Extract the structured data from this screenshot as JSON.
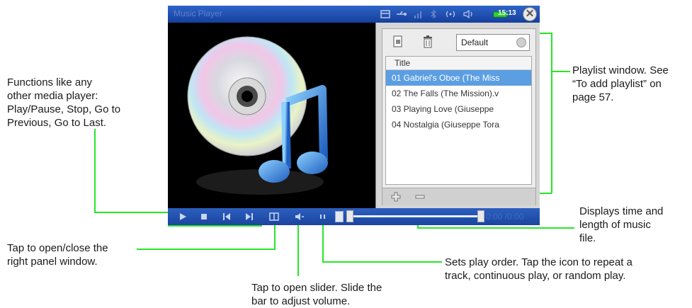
{
  "app": {
    "title": "Music Player",
    "clock": "15:13",
    "close_glyph": "✕",
    "status_icons": [
      "window-icon",
      "usb-icon",
      "signal-icon",
      "bluetooth-icon",
      "wifi-icon",
      "volume-icon",
      "battery-icon"
    ]
  },
  "playlist": {
    "preset": "Default",
    "column_title": "Title",
    "tracks": [
      "01 Gabriel's Oboe (The Miss",
      "02 The Falls (The Mission).v",
      "03 Playing Love (Giuseppe",
      "04 Nostalgia (Giuseppe Tora"
    ],
    "selected_index": 0
  },
  "controls": {
    "time": "0:00 /0:00",
    "buttons": [
      "play-icon",
      "stop-icon",
      "previous-icon",
      "next-icon",
      "panel-toggle-icon",
      "volume-icon",
      "play-order-icon"
    ],
    "seek_fraction": 0
  },
  "annotations": {
    "functions": [
      "Functions like any",
      "other media player:",
      "Play/Pause, Stop, Go to",
      "Previous, Go to Last."
    ],
    "playlist": [
      "Playlist window. See",
      "“To add playlist” on",
      "page 57."
    ],
    "time": [
      "Displays time and",
      "length of music",
      "file."
    ],
    "panel": [
      "Tap to open/close the",
      "right panel window."
    ],
    "order": [
      "Sets play order. Tap the icon to repeat a",
      "track, continuous play, or random play."
    ],
    "volume": [
      "Tap to open slider. Slide the",
      "bar to adjust volume."
    ]
  },
  "colors": {
    "callout": "#27e627",
    "title_bar": "#2455b6",
    "selection": "#5c9ee2"
  }
}
